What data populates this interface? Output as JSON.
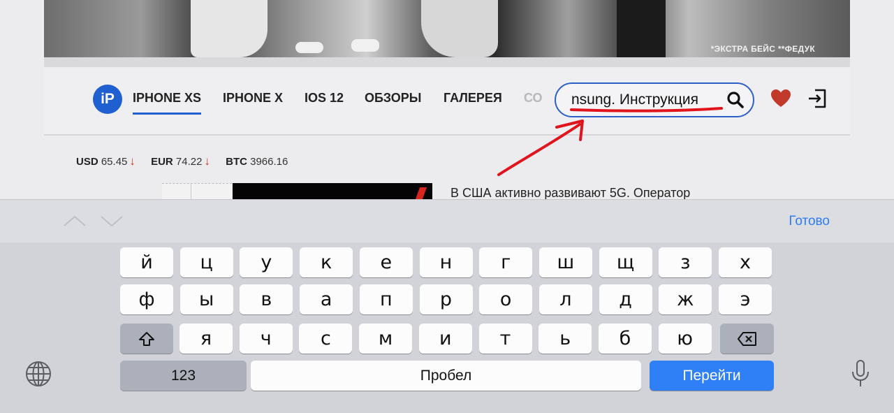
{
  "hero": {
    "caption": "*ЭКСТРА БЕЙС **ФЕДУК"
  },
  "nav": {
    "logo": "iP",
    "items": [
      {
        "label": "IPHONE XS",
        "active": true
      },
      {
        "label": "IPHONE X"
      },
      {
        "label": "IOS 12"
      },
      {
        "label": "ОБЗОРЫ"
      },
      {
        "label": "ГАЛЕРЕЯ"
      },
      {
        "label": "СО"
      }
    ]
  },
  "search": {
    "value": "nsung. Инструкция"
  },
  "rates": [
    {
      "code": "USD",
      "value": "65.45",
      "trend": "↓"
    },
    {
      "code": "EUR",
      "value": "74.22",
      "trend": "↓"
    },
    {
      "code": "BTC",
      "value": "3966.16"
    }
  ],
  "news": {
    "title": "В США активно развивают 5G. Оператор"
  },
  "accessory": {
    "done_label": "Готово"
  },
  "keyboard": {
    "row1": [
      "й",
      "ц",
      "у",
      "к",
      "е",
      "н",
      "г",
      "ш",
      "щ",
      "з",
      "х"
    ],
    "row2": [
      "ф",
      "ы",
      "в",
      "а",
      "п",
      "р",
      "о",
      "л",
      "д",
      "ж",
      "э"
    ],
    "row3": [
      "я",
      "ч",
      "с",
      "м",
      "и",
      "т",
      "ь",
      "б",
      "ю"
    ],
    "numbers_label": "123",
    "space_label": "Пробел",
    "go_label": "Перейти"
  },
  "colors": {
    "accent_blue": "#2f80f7",
    "nav_underline": "#1f5fd0",
    "annotation_red": "#e0141c",
    "heart": "#c0392b"
  }
}
